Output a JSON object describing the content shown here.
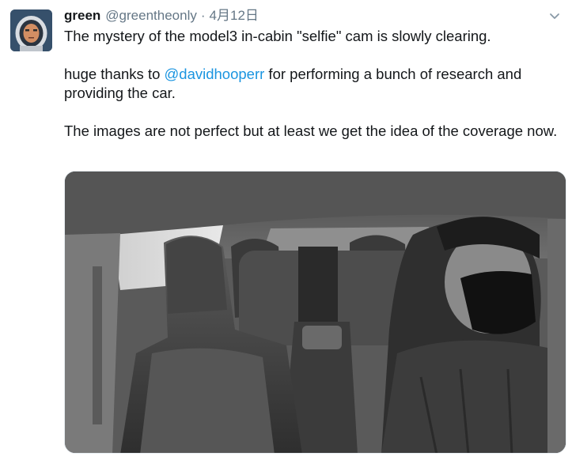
{
  "tweet": {
    "author_name": "green",
    "author_handle": "@greentheonly",
    "separator": "·",
    "date": "4月12日",
    "text_line1": "The mystery of the model3 in-cabin \"selfie\" cam is slowly clearing.",
    "text_p2_before": "huge thanks to ",
    "text_p2_mention": "@davidhooperr",
    "text_p2_after": " for performing a bunch of research and providing the car.",
    "text_p3": "The images are not perfect but at least we get the idea of the coverage now."
  },
  "icons": {
    "avatar": "astronaut-avatar",
    "menu": "chevron-down-icon"
  },
  "colors": {
    "link": "#1b95e0",
    "secondary_text": "#657786",
    "primary_text": "#14171a"
  }
}
